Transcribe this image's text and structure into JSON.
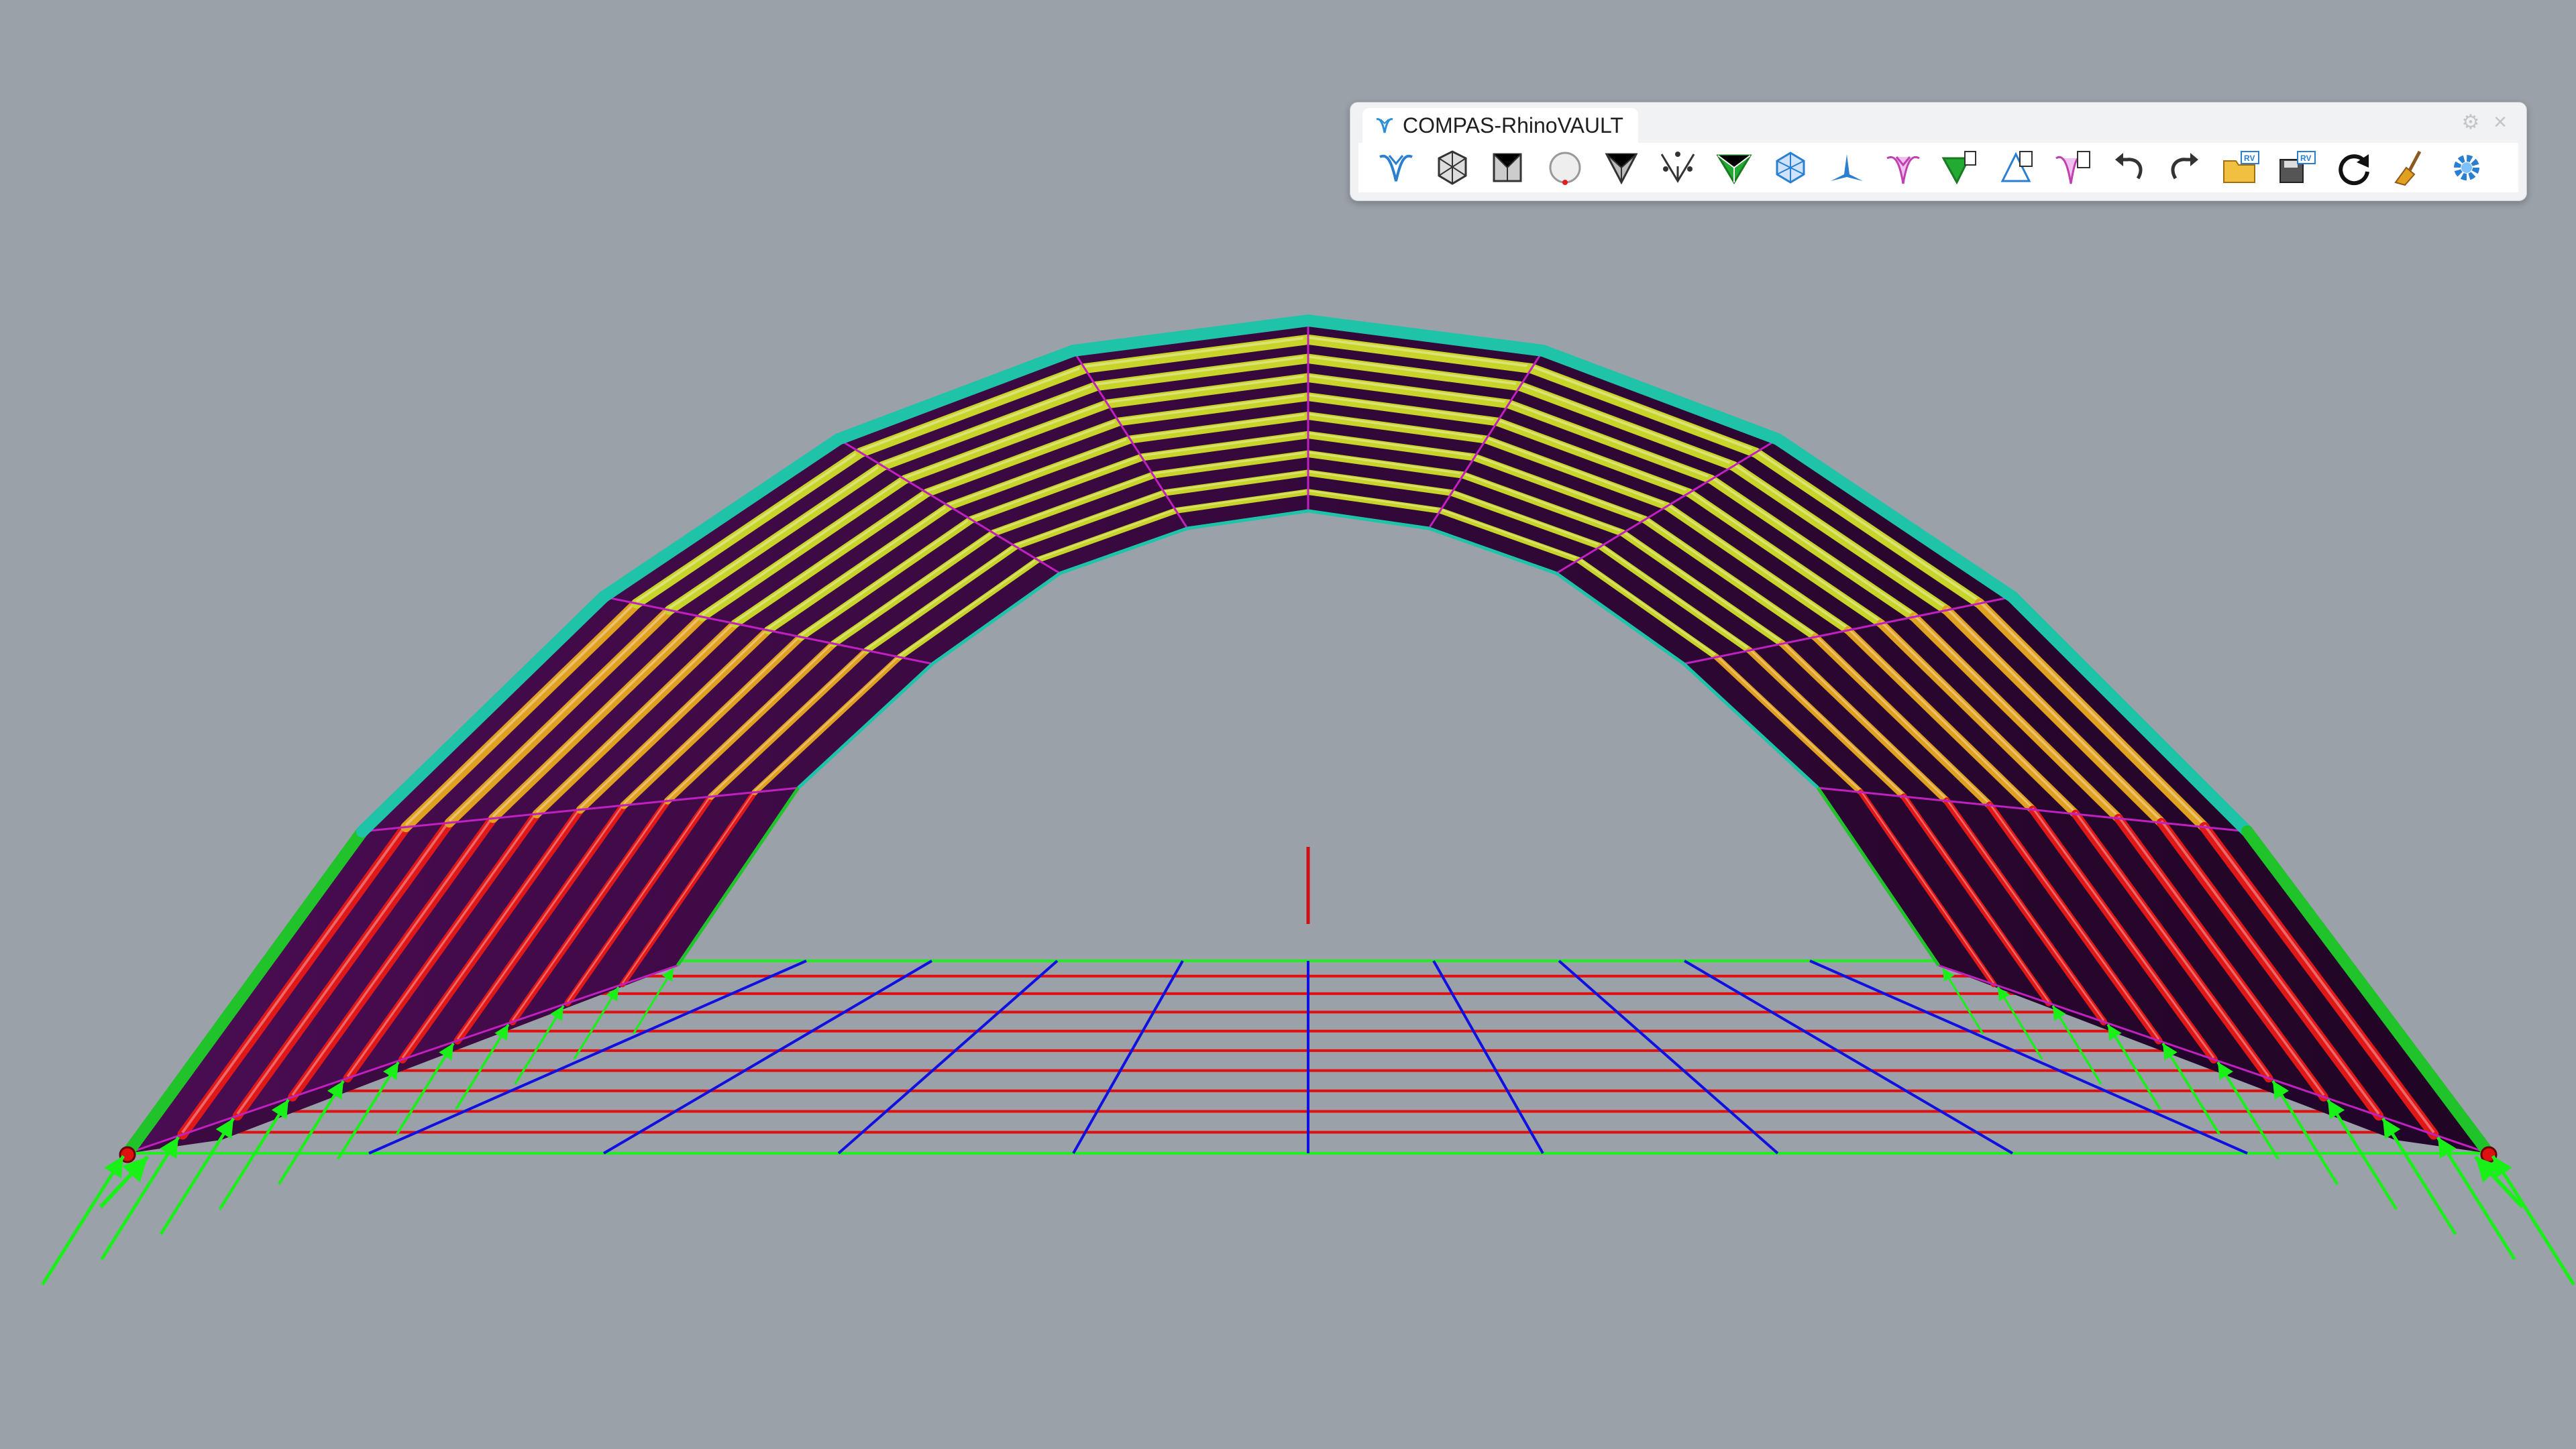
{
  "toolbar": {
    "title": "COMPAS-RhinoVAULT",
    "logo_icon": "rhinovault-logo-icon",
    "settings_icon": "gear-icon",
    "close_icon": "close-icon",
    "buttons": [
      {
        "name": "rv-init-button",
        "icon": "rhinovault-logo-icon"
      },
      {
        "name": "pattern-button",
        "icon": "pattern-icon"
      },
      {
        "name": "boundaries-button",
        "icon": "boundaries-icon"
      },
      {
        "name": "form-button",
        "icon": "form-icon"
      },
      {
        "name": "force-button",
        "icon": "force-icon"
      },
      {
        "name": "tna-horizontal-button",
        "icon": "horizontal-equilibrium-icon"
      },
      {
        "name": "tna-vertical-button",
        "icon": "vertical-equilibrium-icon"
      },
      {
        "name": "thrust-button",
        "icon": "thrust-network-icon"
      },
      {
        "name": "modify-pattern-button",
        "icon": "modify-pattern-icon"
      },
      {
        "name": "modify-form-button",
        "icon": "modify-form-icon"
      },
      {
        "name": "modify-force-button",
        "icon": "modify-force-icon"
      },
      {
        "name": "modify-thrust-button",
        "icon": "modify-thrust-icon"
      },
      {
        "name": "modify-diagram-button",
        "icon": "modify-diagram-icon"
      },
      {
        "name": "undo-button",
        "icon": "undo-icon"
      },
      {
        "name": "redo-button",
        "icon": "redo-icon"
      },
      {
        "name": "open-rv-button",
        "icon": "open-file-icon"
      },
      {
        "name": "save-rv-button",
        "icon": "save-file-icon"
      },
      {
        "name": "reload-button",
        "icon": "refresh-icon"
      },
      {
        "name": "clear-button",
        "icon": "broom-icon"
      },
      {
        "name": "settings-button",
        "icon": "settings-gear-icon"
      }
    ]
  },
  "viewport": {
    "background": "#9aa1a8",
    "vault_fill": "#3d0a44",
    "vault_fill_dark": "#24062a",
    "edge_cyan": "#1fc4a8",
    "edge_green": "#20c42a",
    "compression_yellow": "#c8d42a",
    "compression_orange": "#e0a020",
    "compression_red": "#e01818",
    "grid_red": "#e01010",
    "grid_blue": "#1010e0",
    "grid_green": "#20ee20",
    "reaction_arrow": "#18f018",
    "axis_z": "#d01010"
  }
}
